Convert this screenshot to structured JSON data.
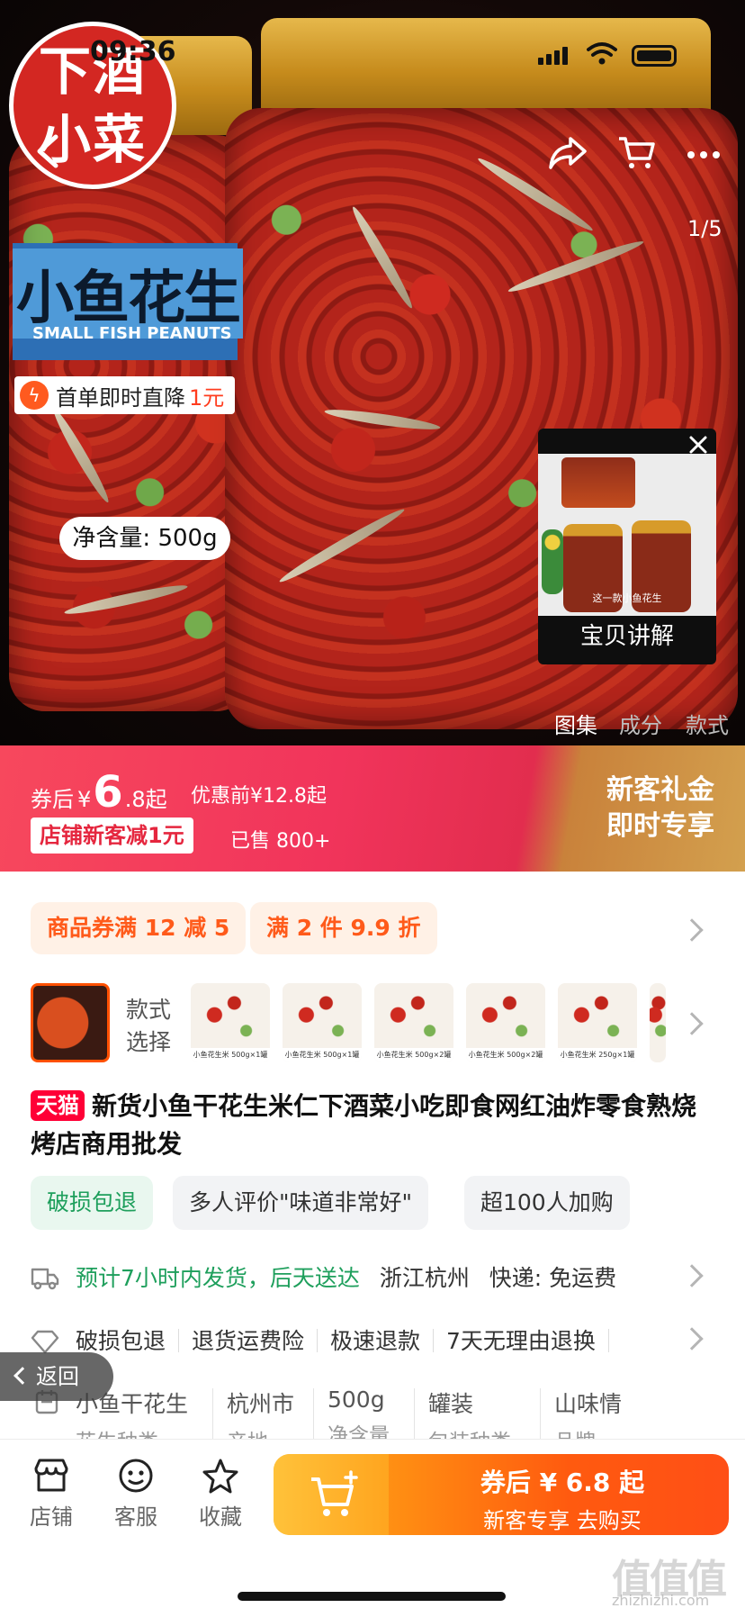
{
  "status_bar": {
    "time": "09:36"
  },
  "hero": {
    "logo_line1": "下酒",
    "logo_line2": "小菜",
    "label_cn": "小鱼花生",
    "label_en": "SMALL FISH PEANUTS",
    "promo_text": "首单即时直降",
    "promo_amount": "1元",
    "net_weight": "净含量: 500g",
    "image_counter": "1/5",
    "video": {
      "caption": "这一款小鱼花生",
      "title": "宝贝讲解"
    },
    "media_tabs": [
      "图集",
      "成分",
      "款式"
    ]
  },
  "price_banner": {
    "coupon_prefix": "券后",
    "currency": "¥",
    "price_int": "6",
    "price_rest": ".8",
    "price_suffix": "起",
    "original": "优惠前¥12.8起",
    "shop_discount": "店铺新客减1元",
    "sold": "已售 800+",
    "right_line1": "新客礼金",
    "right_line2": "即时专享"
  },
  "coupons": [
    "商品券满 12 减 5",
    "满 2 件 9.9 折"
  ],
  "style_selector": {
    "label_line1": "款式",
    "label_line2": "选择",
    "thumbs": [
      "",
      "小鱼花生米 500g×1罐",
      "小鱼花生米 500g×1罐",
      "小鱼花生米 500g×2罐",
      "小鱼花生米 500g×2罐",
      "小鱼花生米 250g×1罐",
      ""
    ]
  },
  "product": {
    "badge": "天猫",
    "title": "新货小鱼干花生米仁下酒菜小吃即食网红油炸零食熟烧烤店商用批发"
  },
  "tags": [
    "破损包退",
    "多人评价\"味道非常好\"",
    "超100人加购"
  ],
  "shipping": {
    "estimate": "预计7小时内发货，后天送达",
    "origin": "浙江杭州",
    "express": "快递: 免运费"
  },
  "services": [
    "破损包退",
    "退货运费险",
    "极速退款",
    "7天无理由退换"
  ],
  "specs": [
    {
      "value": "小鱼干花生",
      "label": "花生种类"
    },
    {
      "value": "杭州市",
      "label": "产地"
    },
    {
      "value": "500g",
      "label": "净含量"
    },
    {
      "value": "罐装",
      "label": "包装种类"
    },
    {
      "value": "山味情",
      "label": "品牌"
    }
  ],
  "back_button": "返回",
  "bottom_bar": {
    "shop": "店铺",
    "service": "客服",
    "favorite": "收藏",
    "buy_line1": "券后 ¥ 6.8 起",
    "buy_line2": "新客专享  去购买"
  },
  "watermark": {
    "logo": "值值值",
    "site": "zhizhizhi.com"
  }
}
